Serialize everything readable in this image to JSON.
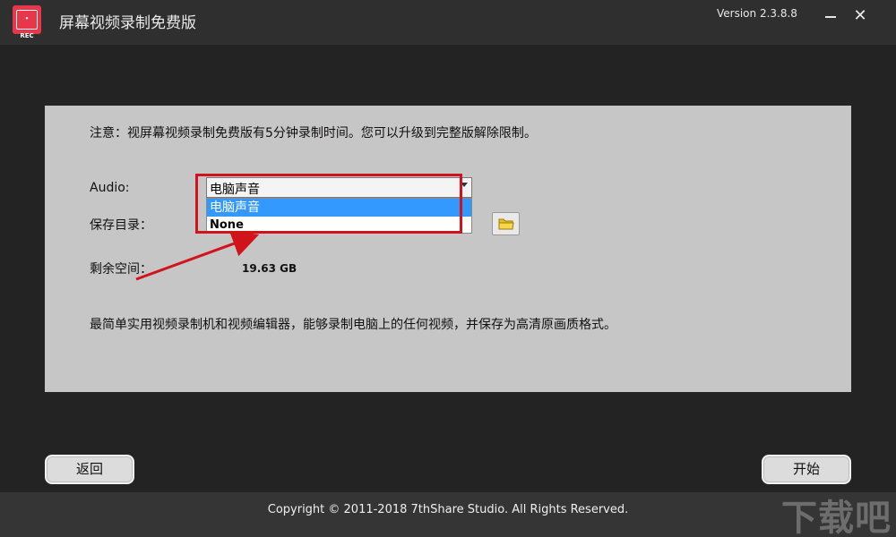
{
  "app": {
    "title": "屏幕视频录制免费版",
    "version": "Version 2.3.8.8",
    "logo_text": "• REC"
  },
  "window_controls": {
    "minimize_icon": "minimize-icon",
    "close_glyph": "✕"
  },
  "panel": {
    "notice": "注意：视屏幕视频录制免费版有5分钟录制时间。您可以升级到完整版解除限制。",
    "audio_label": "Audio:",
    "audio_selected": "电脑声音",
    "audio_options": [
      "电脑声音",
      "None"
    ],
    "save_dir_label": "保存目录：",
    "free_space_label": "剩余空间：",
    "free_space_value": "19.63 GB",
    "description": "最简单实用视频录制机和视频编辑器，能够录制电脑上的任何视频，并保存为高清原画质格式。"
  },
  "buttons": {
    "back": "返回",
    "start": "开始"
  },
  "footer": {
    "copyright": "Copyright © 2011-2018 7thShare Studio. All Rights Reserved."
  },
  "watermark": "下载吧",
  "colors": {
    "accent_red": "#e8364b",
    "annotation_red": "#d1141c",
    "selection_blue": "#3399ff",
    "panel_gray": "#c7c6c6"
  }
}
